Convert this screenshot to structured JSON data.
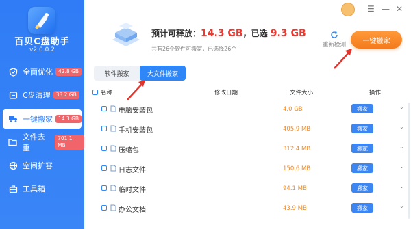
{
  "app": {
    "name": "百贝C盘助手",
    "version": "v2.0.0.2"
  },
  "nav": [
    {
      "label": "全面优化",
      "badge": "42.8 GB",
      "icon": "shield-icon"
    },
    {
      "label": "C盘清理",
      "badge": "33.2 GB",
      "icon": "broom-icon"
    },
    {
      "label": "一键搬家",
      "badge": "14.3 GB",
      "icon": "truck-icon"
    },
    {
      "label": "文件去重",
      "badge": "701.1 MB",
      "icon": "folder-icon"
    },
    {
      "label": "空间扩容",
      "badge": "",
      "icon": "globe-icon"
    },
    {
      "label": "工具箱",
      "badge": "",
      "icon": "toolbox-icon"
    }
  ],
  "summary": {
    "label_release": "预计可释放：",
    "release": "14.3 GB",
    "label_selected": "，已选",
    "selected": "9.3 GB",
    "sub": "共有26个软件可搬家，已选择26个"
  },
  "recheck_label": "重新检测",
  "main_button": "一键搬家",
  "tabs": [
    "软件搬家",
    "大文件搬家"
  ],
  "columns": {
    "name": "名称",
    "date": "修改日期",
    "size": "文件大小",
    "action": "操作"
  },
  "rows": [
    {
      "name": "电脑安装包",
      "size": "4.0 GB",
      "action": "搬家"
    },
    {
      "name": "手机安装包",
      "size": "405.9 MB",
      "action": "搬家"
    },
    {
      "name": "压缩包",
      "size": "312.4 MB",
      "action": "搬家"
    },
    {
      "name": "日志文件",
      "size": "150.6 MB",
      "action": "搬家"
    },
    {
      "name": "临时文件",
      "size": "94.1 MB",
      "action": "搬家"
    },
    {
      "name": "办公文档",
      "size": "43.9 MB",
      "action": "搬家"
    }
  ],
  "colors": {
    "accent": "#2f86f6",
    "orange": "#f37b1d",
    "badge": "#f1646a",
    "size_text": "#f08a24"
  }
}
